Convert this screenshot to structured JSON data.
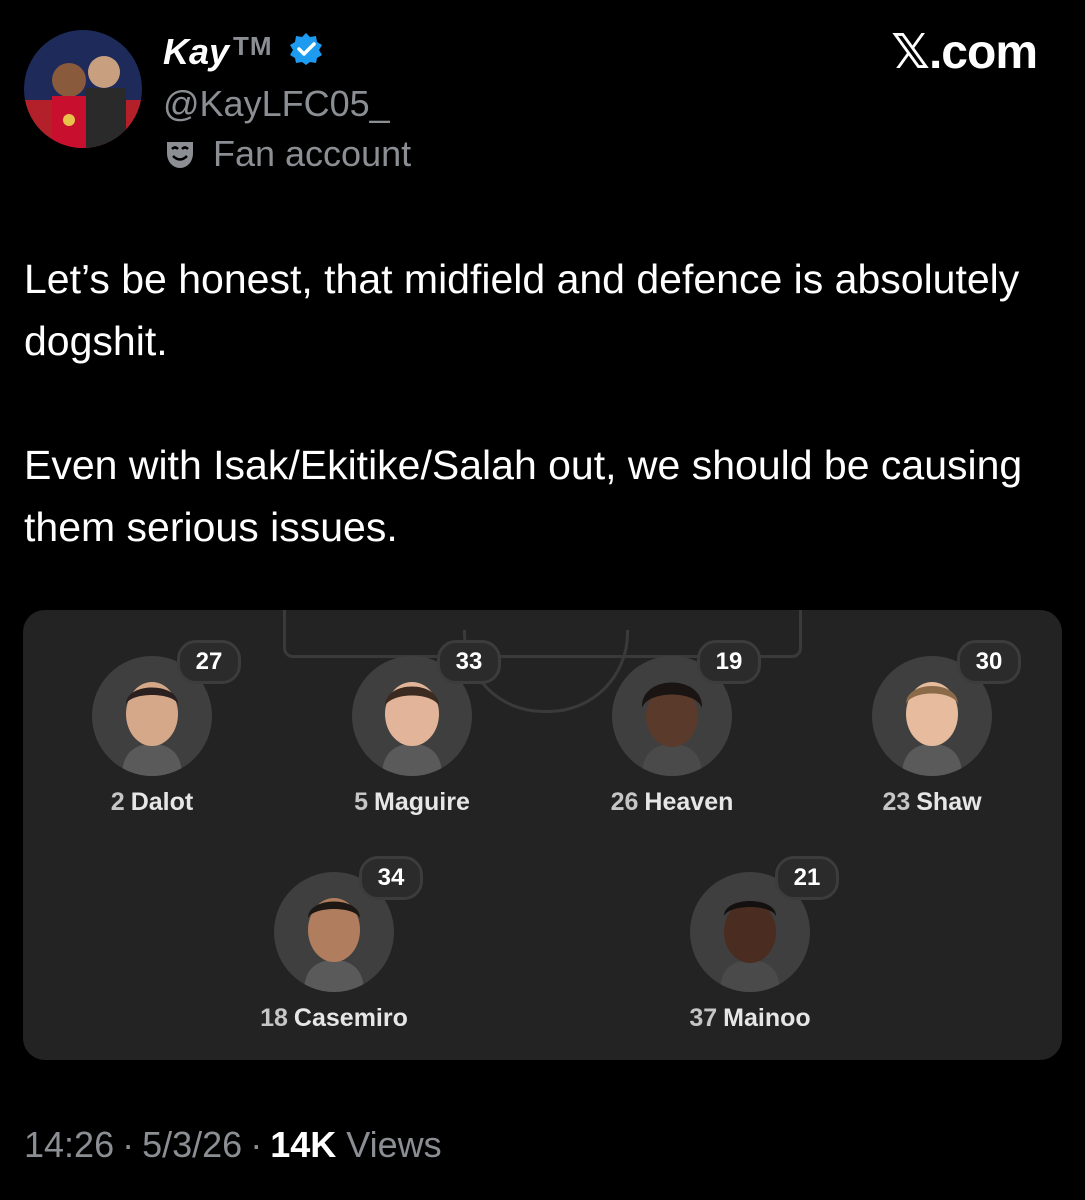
{
  "author": {
    "display_name": "Kay",
    "tm": "TM",
    "handle": "@KayLFC05_",
    "badge": "Fan account",
    "verified": true
  },
  "site_label": "𝕏.com",
  "tweet": {
    "paragraphs": [
      "Let’s be honest, that midfield and defence is absolutely dogshit.",
      "Even with Isak/Ekitike/Salah out, we should be causing them serious issues."
    ]
  },
  "lineup": {
    "defenders": [
      {
        "number": "2",
        "name": "Dalot",
        "rating": "27"
      },
      {
        "number": "5",
        "name": "Maguire",
        "rating": "33"
      },
      {
        "number": "26",
        "name": "Heaven",
        "rating": "19"
      },
      {
        "number": "23",
        "name": "Shaw",
        "rating": "30"
      }
    ],
    "midfielders": [
      {
        "number": "18",
        "name": "Casemiro",
        "rating": "34"
      },
      {
        "number": "37",
        "name": "Mainoo",
        "rating": "21"
      }
    ]
  },
  "meta": {
    "time": "14:26",
    "date": "5/3/26",
    "views_count": "14K",
    "views_label": "Views"
  },
  "colors": {
    "background": "#000000",
    "card": "#232323",
    "muted_text": "#8b8f94",
    "verified_blue": "#1d9bf0"
  }
}
